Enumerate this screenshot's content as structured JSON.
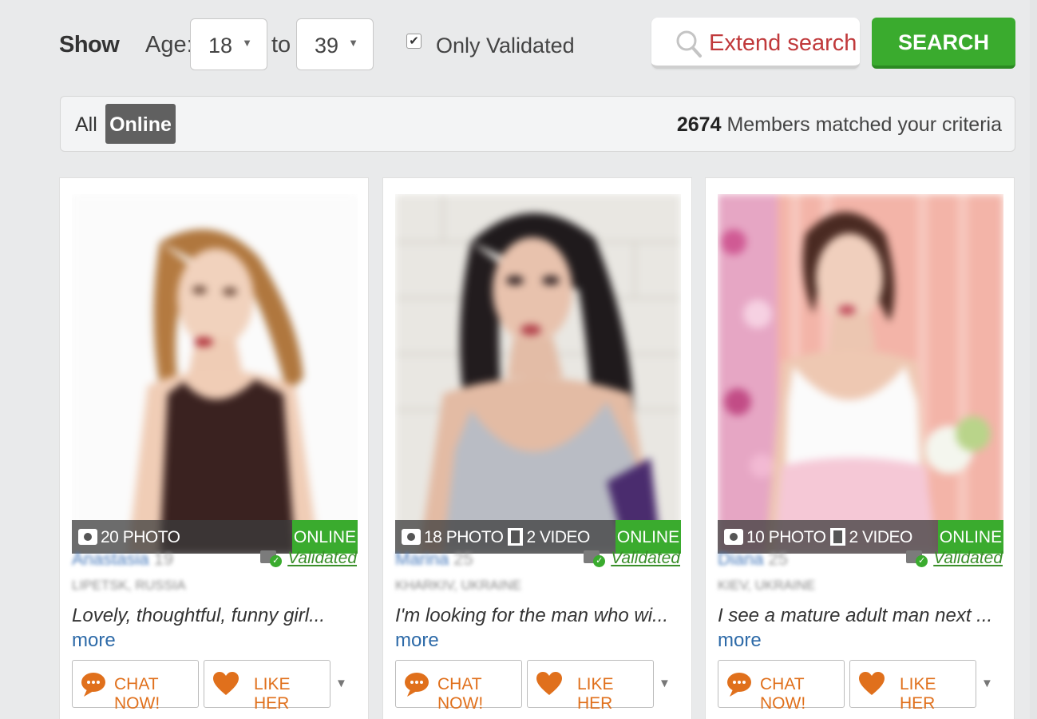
{
  "filters": {
    "show_label": "Show",
    "age_label": "Age:",
    "age_from": "18",
    "to_label": "to",
    "age_to": "39",
    "only_validated_checked": true,
    "only_validated_label": "Only Validated",
    "extend_search_label": "Extend search",
    "search_button_label": "SEARCH"
  },
  "results": {
    "tab_all": "All",
    "tab_online": "Online",
    "match_count": "2674",
    "match_text": "Members matched your criteria"
  },
  "colors": {
    "accent_green": "#3aab2e",
    "extend_red": "#c0393b",
    "action_orange": "#e0701c",
    "link_blue": "#2d6aa8"
  },
  "profiles": [
    {
      "name": "Anastasia",
      "age": "19",
      "location": "LIPETSK, RUSSIA",
      "photos": "20 PHOTO",
      "videos": "",
      "status": "ONLINE",
      "validated": "Validated",
      "description": "Lovely, thoughtful, funny girl...",
      "more": "more",
      "chat_label": "CHAT NOW!",
      "like_label": "LIKE HER"
    },
    {
      "name": "Marina",
      "age": "25",
      "location": "KHARKIV, UKRAINE",
      "photos": "18 PHOTO",
      "videos": "2 VIDEO",
      "status": "ONLINE",
      "validated": "Validated",
      "description": "I'm looking for the man who wi...",
      "more": "more",
      "chat_label": "CHAT NOW!",
      "like_label": "LIKE HER"
    },
    {
      "name": "Diana",
      "age": "25",
      "location": "KIEV, UKRAINE",
      "photos": "10 PHOTO",
      "videos": "2 VIDEO",
      "status": "ONLINE",
      "validated": "Validated",
      "description": "I see a mature adult man next ...",
      "more": "more",
      "chat_label": "CHAT NOW!",
      "like_label": "LIKE HER"
    }
  ],
  "icons": {
    "search": "search-icon",
    "camera": "camera-icon",
    "film": "film-icon",
    "validated": "validated-id-icon",
    "chat": "chat-bubble-icon",
    "like": "heart-icon",
    "dropdown": "chevron-down-icon"
  }
}
